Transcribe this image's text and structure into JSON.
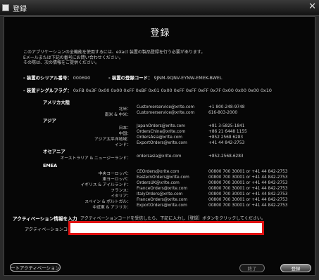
{
  "window": {
    "title": "登録",
    "close_glyph": "✕"
  },
  "dialog": {
    "heading": "登録",
    "intro": [
      "このアプリケーションの全機能を使用するには、eXact 装置の製品登録を行う必要があります。",
      "Eメールまたは下記の番号にお問い合わせください。",
      "その際は、次の情報をご提供ください。"
    ],
    "serial_label": "- 装置のシリアル番号：",
    "serial_value": "000690",
    "regcode_label": "- 装置の登録コード：",
    "regcode_value": "9JNM-9QNV-EYNW-EMEK-BWEL",
    "dongle_label": "- 装置ドングルフラグ：",
    "dongle_value": "0xFB 0x3F 0x00 0x00 0xFF 0xBF 0x01 0x00 0xFF 0xFF 0xFF 0x7F 0x00 0x00 0x00 0x10"
  },
  "contacts": {
    "americas": {
      "heading": "アメリカ大陸",
      "rows": [
        {
          "label": "北米：",
          "email": "Customerservice@xrite.com",
          "phone": "+1 800-248-9748"
        },
        {
          "label": "南米 & 中米：",
          "email": "Customerservice@xrite.com",
          "phone": "616-803-2000"
        }
      ]
    },
    "asia": {
      "heading": "アジア",
      "rows": [
        {
          "label": "日本：",
          "email": "JapanOrders@xrite.com",
          "phone": "+81 3-5825-1841"
        },
        {
          "label": "中国：",
          "email": "OrdersChina@xrite.com",
          "phone": "+86 21 6448 1155"
        },
        {
          "label": "アジア太平洋地域：",
          "email": "OrdersAsia@xrite.com",
          "phone": "+852 2568 6283"
        },
        {
          "label": "インド：",
          "email": "ExportOrders@xrite.com",
          "phone": "+41 44 842-2753"
        }
      ]
    },
    "oceania": {
      "heading": "オセアニア",
      "rows": [
        {
          "label": "オーストラリア & ニュージーランド：",
          "email": "ordersasia@xrite.com",
          "phone": "+852-2568-6283"
        }
      ]
    },
    "emea": {
      "heading": "EMEA",
      "rows": [
        {
          "label": "中央ヨーロッパ：",
          "email": "CEOrders@xrite.com",
          "phone": "00800 700 30001 or +41 44 842-2753"
        },
        {
          "label": "東ヨーロッパ：",
          "email": "EasternOrders@xrite.com",
          "phone": "00800 700 30001 or +41 44 842-2753"
        },
        {
          "label": "イギリス & アイルランド：",
          "email": "OrdersUK@xrite.com",
          "phone": "00800 700 30001 or +41 44 842-2753"
        },
        {
          "label": "フランス：",
          "email": "FranceOrders@xrite.com",
          "phone": "00800 700 30001 or +41 44 842-2753"
        },
        {
          "label": "イタリア：",
          "email": "ItalyOrders@xrite.com",
          "phone": "00800 700 30001 or +41 44 842-2753"
        },
        {
          "label": "スペイン & ポルトガル：",
          "email": "FranceOrders@xrite.com",
          "phone": "00800 700 30001 or +41 44 842-2753"
        },
        {
          "label": "中近東 & アフリカ：",
          "email": "ExportOrders@xrite.com",
          "phone": "00800 700 30001 or +41 44 842-2753"
        }
      ]
    }
  },
  "activation": {
    "section_label": "アクティベーション情報を入力",
    "instruction": "アクティベーションコードを受信したら、下記に入力し［登録］ボタンをクリックしてください。",
    "code_label": "アクティベーションコード：",
    "code_value": ""
  },
  "buttons": {
    "left_label": "ートアクティベーション",
    "exit_label": "終了",
    "register_label": "登録"
  },
  "colors": {
    "highlight_border": "#e01010",
    "dialog_bg": "#060606"
  }
}
